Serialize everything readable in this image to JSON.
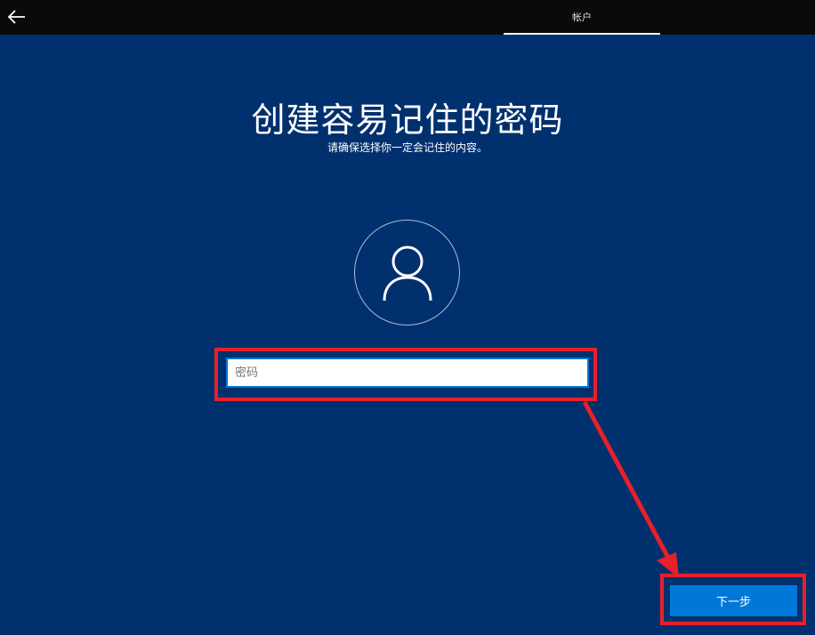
{
  "header": {
    "back_icon": "back-arrow-icon",
    "tab_label": "帐户"
  },
  "main": {
    "title": "创建容易记住的密码",
    "subtitle": "请确保选择你一定会记住的内容。",
    "avatar_icon": "user-icon",
    "password": {
      "placeholder": "密码",
      "value": ""
    },
    "next_label": "下一步"
  },
  "annotations": {
    "highlight_color": "#e8202a",
    "arrow_icon": "red-arrow-annotation"
  },
  "colors": {
    "background": "#00306e",
    "topbar": "#0a0a0a",
    "accent": "#0078d7"
  }
}
